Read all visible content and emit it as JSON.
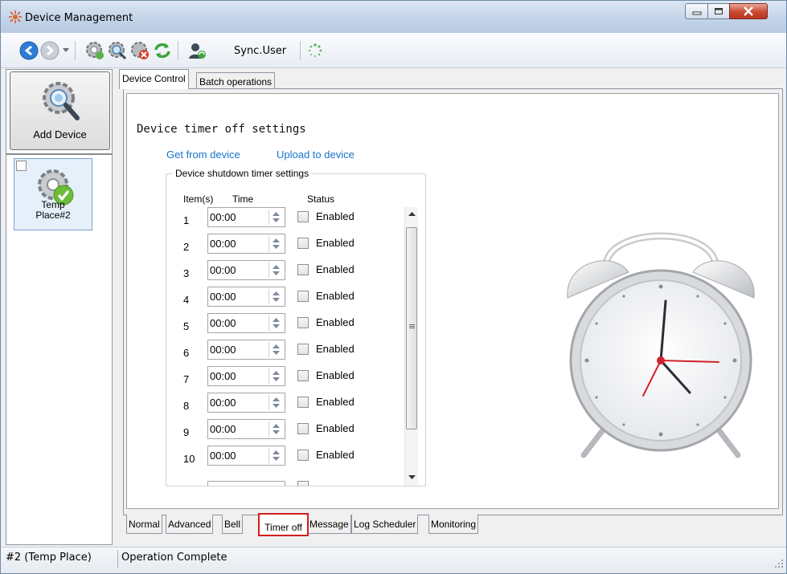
{
  "window": {
    "title": "Device Management",
    "icons": {
      "app": "app-icon",
      "minimize": "minimize-icon",
      "maximize": "maximize-icon",
      "close": "close-icon"
    }
  },
  "toolbar": {
    "buttons": [
      {
        "icon": "back-arrow-icon"
      },
      {
        "icon": "forward-arrow-icon"
      },
      {
        "icon": "dropdown-arrow-icon"
      },
      {
        "icon": "device-settings-icon"
      },
      {
        "icon": "search-device-icon"
      },
      {
        "icon": "delete-device-icon"
      },
      {
        "icon": "refresh-icon"
      },
      {
        "icon": "sync-user-icon"
      },
      {
        "icon": "loading-spinner-icon"
      }
    ],
    "sync_label": "Sync.User"
  },
  "sidebar": {
    "add_device_label": "Add Device",
    "add_device_icon": "add-device-gear-icon",
    "device": {
      "label_line1": "Temp",
      "label_line2": "Place#2",
      "icon": "device-online-gear-icon"
    }
  },
  "main": {
    "top_tabs": [
      "Device Control",
      "Batch operations"
    ],
    "active_top_tab": "Device Control",
    "section_title": "Device timer off settings",
    "links": {
      "get": "Get from device",
      "upload": "Upload to device"
    },
    "group_title": "Device shutdown timer settings",
    "headers": {
      "item": "Item(s)",
      "time": "Time",
      "status": "Status"
    },
    "rows": [
      {
        "num": "1",
        "time": "00:00",
        "status": "Enabled",
        "checked": false
      },
      {
        "num": "2",
        "time": "00:00",
        "status": "Enabled",
        "checked": false
      },
      {
        "num": "3",
        "time": "00:00",
        "status": "Enabled",
        "checked": false
      },
      {
        "num": "4",
        "time": "00:00",
        "status": "Enabled",
        "checked": false
      },
      {
        "num": "5",
        "time": "00:00",
        "status": "Enabled",
        "checked": false
      },
      {
        "num": "6",
        "time": "00:00",
        "status": "Enabled",
        "checked": false
      },
      {
        "num": "7",
        "time": "00:00",
        "status": "Enabled",
        "checked": false
      },
      {
        "num": "8",
        "time": "00:00",
        "status": "Enabled",
        "checked": false
      },
      {
        "num": "9",
        "time": "00:00",
        "status": "Enabled",
        "checked": false
      },
      {
        "num": "10",
        "time": "00:00",
        "status": "Enabled",
        "checked": false
      }
    ],
    "illustration_icon": "alarm-clock-icon",
    "bottom_tabs": [
      "Normal",
      "Advanced",
      "Bell",
      "Timer off",
      "Message",
      "Log Scheduler",
      "Monitoring"
    ],
    "active_bottom_tab": "Timer off",
    "highlight_color": "#d11e1e"
  },
  "status": {
    "device": "#2 (Temp Place)",
    "message": "Operation Complete"
  },
  "colors": {
    "link": "#1874cd",
    "accent": "#d11e1e"
  }
}
